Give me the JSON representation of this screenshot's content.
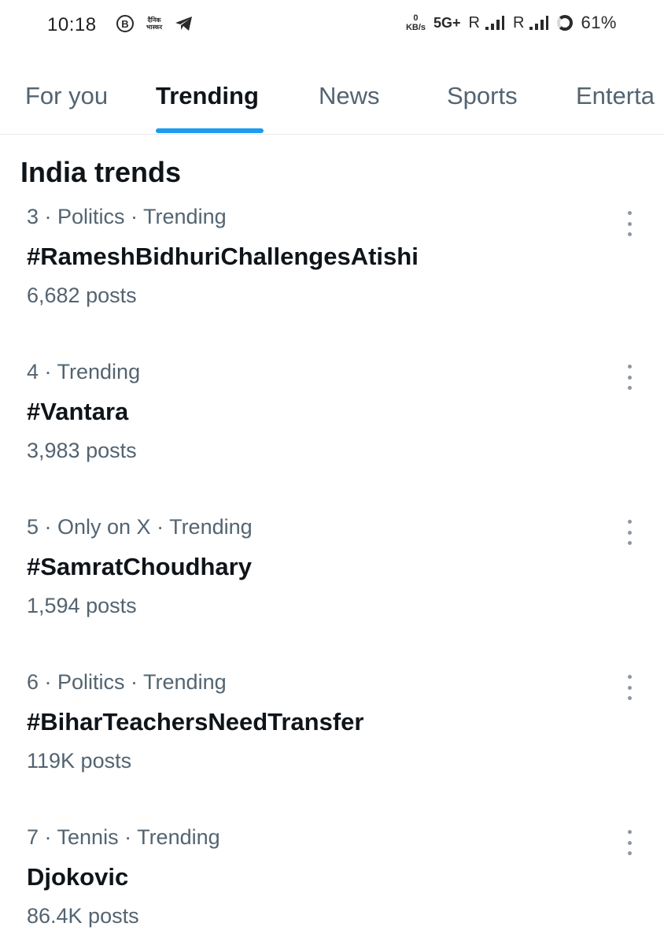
{
  "status_bar": {
    "time": "10:18",
    "kbs_top": "0",
    "kbs_bottom": "KB/s",
    "network": "5G+",
    "sim1": "R",
    "sim2": "R",
    "battery": "61%",
    "app_icon_b": "B",
    "app_icon_bhaskar_line1": "दैनिक",
    "app_icon_bhaskar_line2": "भास्कर"
  },
  "tabs": [
    {
      "label": "For you",
      "active": false
    },
    {
      "label": "Trending",
      "active": true
    },
    {
      "label": "News",
      "active": false
    },
    {
      "label": "Sports",
      "active": false
    },
    {
      "label": "Enterta",
      "active": false
    }
  ],
  "section_title": "India trends",
  "trends": [
    {
      "meta": "3 · Politics · Trending",
      "name": "#RameshBidhuriChallengesAtishi",
      "count": "6,682 posts"
    },
    {
      "meta": "4 · Trending",
      "name": "#Vantara",
      "count": "3,983 posts"
    },
    {
      "meta": "5 · Only on X · Trending",
      "name": "#SamratChoudhary",
      "count": "1,594 posts"
    },
    {
      "meta": "6 · Politics · Trending",
      "name": "#BiharTeachersNeedTransfer",
      "count": "119K posts"
    },
    {
      "meta": "7 · Tennis · Trending",
      "name": "Djokovic",
      "count": "86.4K posts"
    }
  ],
  "colors": {
    "accent": "#1d9bf0",
    "primary_text": "#0f1419",
    "secondary_text": "#536471"
  },
  "icons": {
    "more": "more-vertical-icon",
    "telegram": "telegram-icon",
    "signal": "signal-bars-icon",
    "battery": "battery-ring-icon"
  }
}
